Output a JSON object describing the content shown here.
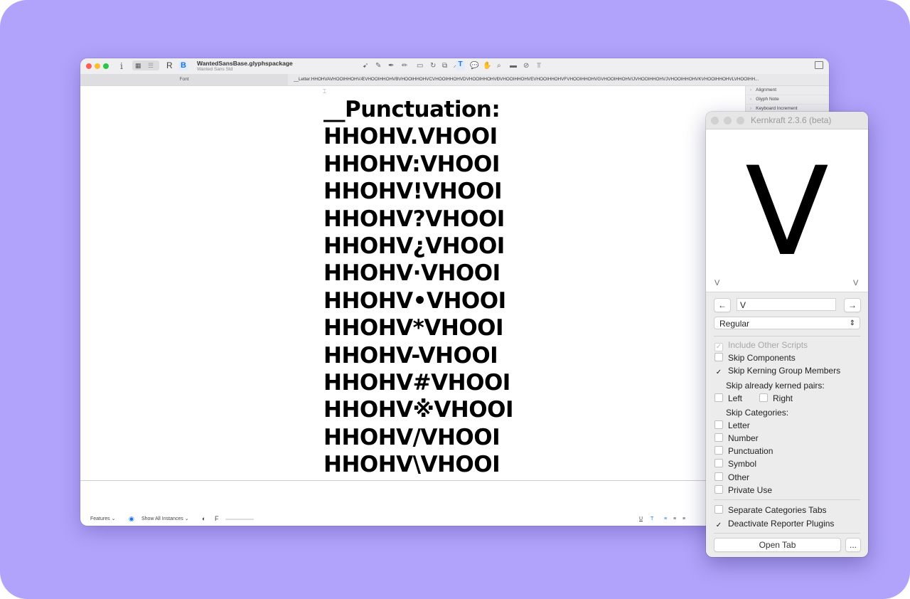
{
  "window": {
    "title": "WantedSansBase.glyphspackage",
    "subtitle": "Wanted Sans Std",
    "tab_font": "Font",
    "tab_edit": "__Letter:HHOHVAVHOOIHHOHVÆVHOOIHHOHVBVHOOIHHOHVCVHOOIHHOHVDVHOOIHHOHVÐVHOOIHHOHVEVHOOIHHOHVFVHOOIHHOHVGVHOOIHHOHVIJVHOOIHHOHVJVHOOIHHOHVKVHOOIHHOHVLVHOOIHH...",
    "toolbar_letters": {
      "r": "R",
      "b": "B",
      "info": "i"
    }
  },
  "sample_lines": [
    "__Punctuation:",
    "HHOHV.VHOOI",
    "HHOHV:VHOOI",
    "HHOHV!VHOOI",
    "HHOHV?VHOOI",
    "HHOHV¿VHOOI",
    "HHOHV·VHOOI",
    "HHOHV•VHOOI",
    "HHOHV*VHOOI",
    "HHOHV-VHOOI",
    "HHOHV#VHOOI",
    "HHOHV※VHOOI",
    "HHOHV/VHOOI",
    "HHOHV\\VHOOI"
  ],
  "side_panel": [
    "Alignment",
    "Glyph Note",
    "Keyboard Increment"
  ],
  "footer": {
    "features": "Features",
    "instances": "Show All Instances",
    "f_label": "F"
  },
  "kernkraft": {
    "title": "Kernkraft 2.3.6 (beta)",
    "preview_glyph": "V",
    "left_glyph": "V",
    "right_glyph": "V",
    "prev_arrow": "←",
    "next_arrow": "→",
    "glyph_field": "V",
    "master_select": "Regular",
    "include_other_scripts": "Include Other Scripts",
    "skip_components": "Skip Components",
    "skip_kerning_group": "Skip Kerning Group Members",
    "skip_kerned_pairs": "Skip already kerned pairs:",
    "left": "Left",
    "right": "Right",
    "skip_categories": "Skip Categories:",
    "categories": [
      "Letter",
      "Number",
      "Punctuation",
      "Symbol",
      "Other",
      "Private Use"
    ],
    "separate_tabs": "Separate Categories Tabs",
    "deactivate_plugins": "Deactivate Reporter Plugins",
    "open_tab": "Open Tab",
    "more": "..."
  },
  "colors": {
    "background": "#b1a3fb",
    "accent": "#1a73e8"
  }
}
